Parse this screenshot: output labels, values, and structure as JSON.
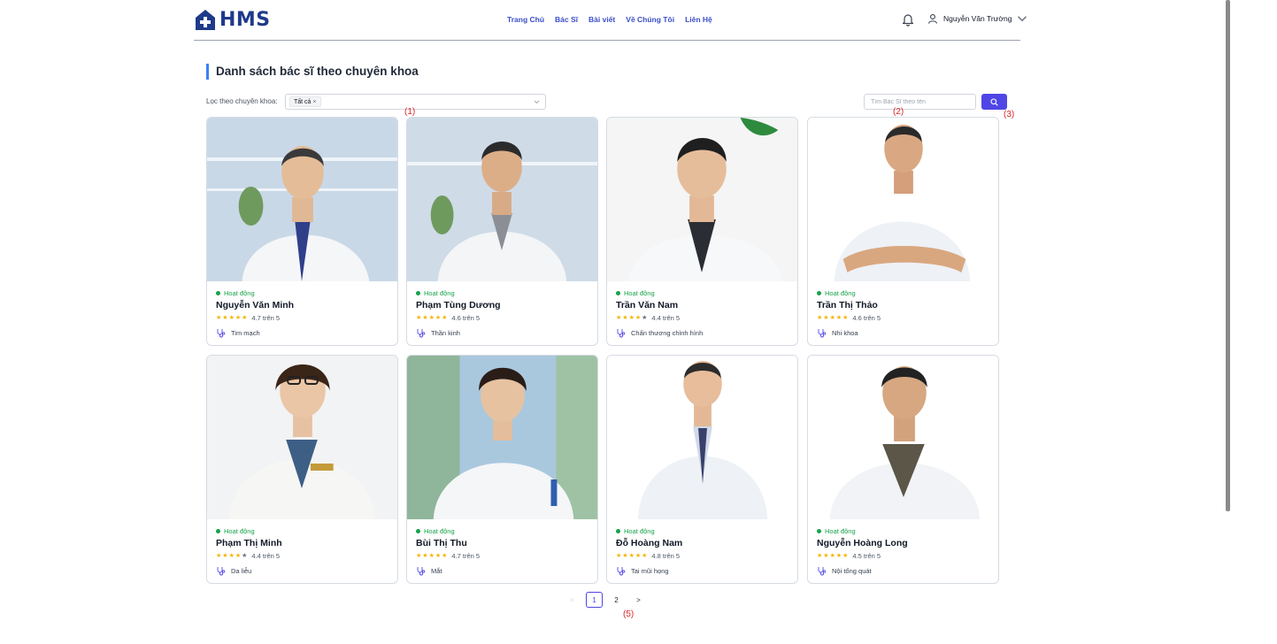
{
  "brand": {
    "name": "HMS",
    "color": "#1e3a8a",
    "accent": "#4f46e5"
  },
  "nav": [
    "Trang Chủ",
    "Bác Sĩ",
    "Bài viết",
    "Về Chúng Tôi",
    "Liên Hệ"
  ],
  "user": {
    "name": "Nguyễn Văn Trường",
    "icons": [
      "bell-icon",
      "user-icon",
      "chevron-down-icon"
    ]
  },
  "page": {
    "title": "Danh sách bác sĩ theo chuyên khoa"
  },
  "filter": {
    "label": "Lọc theo chuyên khoa:",
    "selected_tag": "Tất cả",
    "remove_symbol": "×"
  },
  "search": {
    "placeholder": "Tìm Bác Sĩ theo tên",
    "value": ""
  },
  "annotations": [
    "(1)",
    "(2)",
    "(3)",
    "(5)"
  ],
  "doctors": [
    {
      "status": "Hoạt động",
      "name": "Nguyễn Văn Minh",
      "rating": "4.7 trên 5",
      "stars": 5,
      "specialty": "Tim mạch"
    },
    {
      "status": "Hoạt động",
      "name": "Phạm Tùng Dương",
      "rating": "4.6 trên 5",
      "stars": 5,
      "specialty": "Thần kinh"
    },
    {
      "status": "Hoạt động",
      "name": "Trần Văn Nam",
      "rating": "4.4 trên 5",
      "stars": 4,
      "specialty": "Chấn thương chỉnh hình"
    },
    {
      "status": "Hoạt động",
      "name": "Trần Thị Thảo",
      "rating": "4.6 trên 5",
      "stars": 5,
      "specialty": "Nhi khoa"
    },
    {
      "status": "Hoạt động",
      "name": "Phạm Thị Minh",
      "rating": "4.4 trên 5",
      "stars": 4,
      "specialty": "Da liễu"
    },
    {
      "status": "Hoạt động",
      "name": "Bùi Thị Thu",
      "rating": "4.7 trên 5",
      "stars": 5,
      "specialty": "Mắt"
    },
    {
      "status": "Hoạt động",
      "name": "Đỗ Hoàng Nam",
      "rating": "4.8 trên 5",
      "stars": 5,
      "specialty": "Tai mũi họng"
    },
    {
      "status": "Hoạt động",
      "name": "Nguyễn Hoàng Long",
      "rating": "4.5 trên 5",
      "stars": 5,
      "specialty": "Nội tổng quát"
    }
  ],
  "pagination": {
    "prev": "<",
    "pages": [
      "1",
      "2"
    ],
    "current": "1",
    "next": ">"
  },
  "colors": {
    "status": "#16a34a",
    "star": "#f5b301",
    "nav_link": "#3b4ec8",
    "annotation": "#dc2626"
  }
}
